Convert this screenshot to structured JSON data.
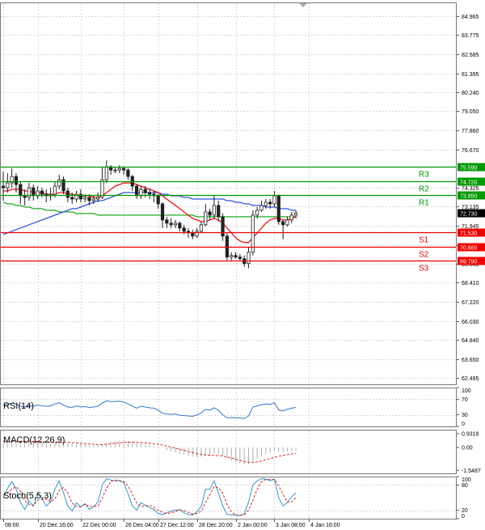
{
  "chart_data": {
    "type": "candlestick",
    "main": {
      "y_ticks": [
        "84.965",
        "83.775",
        "82.585",
        "81.395",
        "80.240",
        "79.050",
        "77.860",
        "76.670",
        "74.325",
        "73.135",
        "71.945",
        "70.755",
        "69.565",
        "68.410",
        "67.220",
        "66.030",
        "64.840",
        "63.650",
        "62.495"
      ],
      "y_tick_values": [
        84.965,
        83.775,
        82.585,
        81.395,
        80.24,
        79.05,
        77.86,
        76.67,
        74.325,
        73.135,
        71.945,
        70.755,
        69.565,
        68.41,
        67.22,
        66.03,
        64.84,
        63.65,
        62.495
      ],
      "ylim": [
        62.1,
        85.8
      ],
      "grid": true,
      "levels": [
        {
          "name": "R3",
          "value": 75.59,
          "label": "75.590",
          "color": "#009900"
        },
        {
          "name": "R2",
          "value": 74.72,
          "label": "74.720",
          "color": "#009900"
        },
        {
          "name": "R1",
          "value": 73.85,
          "label": "73.850",
          "color": "#009900"
        },
        {
          "name": "S1",
          "value": 71.53,
          "label": "71.530",
          "color": "#ee0000"
        },
        {
          "name": "S2",
          "value": 70.66,
          "label": "70.660",
          "color": "#ee0000"
        },
        {
          "name": "S3",
          "value": 69.79,
          "label": "69.790",
          "color": "#ee0000"
        }
      ],
      "current_price": {
        "value": 72.73,
        "label": "72.730"
      },
      "candles": [
        [
          74.4,
          74.3,
          75.3,
          73.5
        ],
        [
          74.3,
          74.6,
          75.2,
          74.0
        ],
        [
          74.6,
          75.0,
          75.5,
          74.3
        ],
        [
          75.0,
          74.5,
          75.2,
          74.0
        ],
        [
          74.5,
          73.8,
          74.7,
          73.3
        ],
        [
          73.8,
          73.7,
          74.2,
          73.2
        ],
        [
          73.7,
          74.3,
          74.6,
          73.5
        ],
        [
          74.3,
          73.8,
          74.5,
          73.5
        ],
        [
          73.8,
          74.1,
          74.4,
          73.6
        ],
        [
          74.1,
          73.9,
          74.3,
          73.7
        ],
        [
          73.9,
          73.8,
          74.2,
          73.4
        ],
        [
          73.8,
          73.9,
          74.3,
          73.5
        ],
        [
          73.9,
          74.4,
          74.7,
          73.7
        ],
        [
          74.4,
          74.8,
          75.1,
          74.2
        ],
        [
          74.8,
          74.1,
          75.0,
          73.9
        ],
        [
          74.1,
          73.7,
          74.3,
          73.4
        ],
        [
          73.7,
          73.6,
          74.0,
          73.3
        ],
        [
          73.6,
          73.9,
          74.1,
          73.4
        ],
        [
          73.9,
          73.6,
          74.2,
          73.4
        ],
        [
          73.6,
          73.7,
          73.9,
          73.4
        ],
        [
          73.7,
          73.5,
          73.9,
          73.2
        ],
        [
          73.5,
          73.6,
          73.8,
          73.3
        ],
        [
          73.6,
          73.7,
          74.0,
          73.4
        ],
        [
          73.7,
          74.8,
          75.6,
          73.6
        ],
        [
          74.8,
          75.6,
          76.0,
          74.6
        ],
        [
          75.6,
          75.4,
          75.7,
          75.1
        ],
        [
          75.4,
          75.4,
          75.6,
          75.2
        ],
        [
          75.4,
          75.5,
          75.7,
          75.2
        ],
        [
          75.5,
          75.4,
          75.6,
          75.1
        ],
        [
          75.4,
          75.0,
          75.5,
          74.8
        ],
        [
          75.0,
          74.4,
          75.1,
          74.1
        ],
        [
          74.4,
          73.8,
          74.5,
          73.6
        ],
        [
          73.8,
          74.2,
          74.4,
          73.6
        ],
        [
          74.2,
          74.0,
          74.4,
          73.7
        ],
        [
          74.0,
          73.9,
          74.2,
          73.6
        ],
        [
          73.9,
          73.8,
          74.1,
          73.4
        ],
        [
          73.8,
          73.3,
          73.9,
          73.0
        ],
        [
          73.3,
          72.3,
          73.4,
          71.8
        ],
        [
          72.3,
          72.1,
          72.5,
          71.8
        ],
        [
          72.1,
          72.0,
          72.4,
          71.8
        ],
        [
          72.0,
          72.1,
          72.3,
          71.8
        ],
        [
          72.1,
          71.8,
          72.2,
          71.6
        ],
        [
          71.8,
          71.6,
          72.0,
          71.4
        ],
        [
          71.6,
          71.5,
          71.8,
          71.2
        ],
        [
          71.5,
          71.3,
          71.7,
          71.1
        ],
        [
          71.3,
          71.6,
          71.8,
          71.2
        ],
        [
          71.6,
          72.0,
          72.2,
          71.5
        ],
        [
          72.0,
          72.8,
          73.3,
          71.9
        ],
        [
          72.8,
          72.6,
          73.0,
          72.3
        ],
        [
          72.6,
          73.2,
          73.8,
          72.4
        ],
        [
          73.2,
          72.5,
          73.5,
          72.2
        ],
        [
          72.5,
          71.3,
          72.7,
          71.0
        ],
        [
          71.3,
          70.0,
          71.5,
          69.8
        ],
        [
          70.0,
          70.1,
          70.3,
          69.8
        ],
        [
          70.1,
          70.0,
          70.3,
          69.9
        ],
        [
          70.0,
          69.9,
          70.2,
          69.8
        ],
        [
          69.9,
          69.6,
          70.1,
          69.4
        ],
        [
          69.6,
          70.3,
          70.6,
          69.3
        ],
        [
          70.3,
          72.6,
          72.9,
          70.1
        ],
        [
          72.6,
          72.9,
          73.1,
          72.4
        ],
        [
          72.9,
          73.2,
          73.5,
          72.8
        ],
        [
          73.2,
          73.4,
          73.6,
          73.0
        ],
        [
          73.4,
          73.3,
          73.6,
          73.0
        ],
        [
          73.3,
          73.8,
          74.1,
          73.1
        ],
        [
          73.8,
          72.2,
          73.9,
          72.0
        ],
        [
          72.2,
          72.0,
          72.3,
          71.1
        ],
        [
          72.0,
          72.3,
          72.5,
          71.9
        ],
        [
          72.3,
          72.6,
          72.8,
          72.1
        ],
        [
          72.6,
          72.73,
          72.9,
          72.4
        ]
      ],
      "ma_red": [
        74.1,
        74.1,
        74.2,
        74.2,
        74.2,
        74.1,
        74.1,
        74.0,
        74.0,
        74.0,
        73.9,
        73.9,
        73.9,
        74.0,
        74.0,
        73.9,
        73.9,
        73.8,
        73.8,
        73.8,
        73.8,
        73.7,
        73.7,
        73.8,
        74.0,
        74.2,
        74.4,
        74.5,
        74.6,
        74.6,
        74.6,
        74.5,
        74.4,
        74.3,
        74.2,
        74.1,
        74.0,
        73.8,
        73.6,
        73.4,
        73.2,
        73.0,
        72.8,
        72.6,
        72.4,
        72.3,
        72.2,
        72.2,
        72.3,
        72.4,
        72.3,
        72.1,
        71.8,
        71.5,
        71.2,
        71.0,
        70.9,
        70.9,
        71.2,
        71.5,
        71.8,
        72.1,
        72.3,
        72.4,
        72.4,
        72.3,
        72.3,
        72.4,
        72.5
      ],
      "ma_blue": [
        71.4,
        71.5,
        71.6,
        71.7,
        71.8,
        71.9,
        72.0,
        72.1,
        72.2,
        72.3,
        72.4,
        72.5,
        72.6,
        72.7,
        72.8,
        72.9,
        73.0,
        73.0,
        73.1,
        73.2,
        73.3,
        73.4,
        73.5,
        73.5,
        73.6,
        73.7,
        73.8,
        73.9,
        74.0,
        74.0,
        74.0,
        74.0,
        74.0,
        74.0,
        74.0,
        74.0,
        74.0,
        73.9,
        73.9,
        73.8,
        73.8,
        73.8,
        73.7,
        73.7,
        73.6,
        73.6,
        73.6,
        73.6,
        73.6,
        73.6,
        73.6,
        73.6,
        73.5,
        73.5,
        73.4,
        73.4,
        73.3,
        73.3,
        73.2,
        73.2,
        73.2,
        73.1,
        73.1,
        73.1,
        73.0,
        73.0,
        73.0,
        72.9,
        72.9
      ],
      "ma_green": [
        73.4,
        73.3,
        73.3,
        73.2,
        73.2,
        73.1,
        73.1,
        73.0,
        73.0,
        73.0,
        72.9,
        72.9,
        72.9,
        72.8,
        72.8,
        72.8,
        72.8,
        72.7,
        72.7,
        72.7,
        72.7,
        72.7,
        72.6,
        72.6,
        72.6,
        72.6,
        72.6,
        72.6,
        72.6,
        72.6,
        72.6,
        72.6,
        72.6,
        72.6,
        72.6,
        72.6,
        72.6,
        72.6,
        72.6,
        72.6,
        72.6,
        72.6,
        72.6,
        72.6,
        72.6,
        72.5,
        72.5,
        72.5,
        72.5,
        72.5,
        72.5,
        72.5,
        72.5,
        72.5,
        72.5,
        72.5,
        72.5,
        72.5,
        72.5,
        72.5,
        72.5,
        72.5,
        72.5,
        72.5,
        72.5,
        72.5,
        72.5,
        72.5,
        72.5
      ]
    },
    "rsi": {
      "label": "RSI(14)",
      "y_ticks": [
        "100",
        "70",
        "30",
        "0"
      ],
      "y_tick_values": [
        100,
        70,
        30,
        0
      ],
      "ylim": [
        0,
        100
      ],
      "values": [
        55,
        57,
        60,
        57,
        52,
        50,
        54,
        52,
        55,
        53,
        52,
        53,
        58,
        61,
        55,
        50,
        49,
        53,
        50,
        51,
        49,
        50,
        52,
        60,
        66,
        64,
        64,
        65,
        63,
        58,
        52,
        47,
        52,
        50,
        48,
        47,
        42,
        34,
        32,
        31,
        32,
        29,
        28,
        27,
        26,
        30,
        35,
        44,
        42,
        48,
        41,
        30,
        22,
        23,
        22,
        22,
        20,
        27,
        50,
        53,
        56,
        58,
        57,
        61,
        42,
        40,
        44,
        47,
        49
      ]
    },
    "macd": {
      "label": "MACD(12,26,9)",
      "y_ticks": [
        "0.9318",
        "0.00",
        "-1.5487"
      ],
      "y_tick_values": [
        0.9318,
        0,
        -1.5487
      ],
      "ylim": [
        -1.75,
        1.2
      ],
      "hist": [
        0.3,
        0.35,
        0.4,
        0.42,
        0.4,
        0.36,
        0.36,
        0.34,
        0.34,
        0.32,
        0.3,
        0.28,
        0.3,
        0.34,
        0.32,
        0.28,
        0.24,
        0.23,
        0.2,
        0.18,
        0.15,
        0.13,
        0.12,
        0.2,
        0.32,
        0.4,
        0.44,
        0.46,
        0.46,
        0.43,
        0.36,
        0.28,
        0.24,
        0.2,
        0.16,
        0.12,
        0.06,
        -0.06,
        -0.18,
        -0.27,
        -0.34,
        -0.42,
        -0.5,
        -0.56,
        -0.62,
        -0.64,
        -0.62,
        -0.56,
        -0.52,
        -0.44,
        -0.46,
        -0.58,
        -0.76,
        -0.88,
        -0.98,
        -1.06,
        -1.14,
        -1.12,
        -0.92,
        -0.76,
        -0.6,
        -0.46,
        -0.36,
        -0.24,
        -0.28,
        -0.3,
        -0.28,
        -0.24,
        -0.2
      ],
      "signal": [
        0.4,
        0.4,
        0.4,
        0.4,
        0.41,
        0.41,
        0.41,
        0.4,
        0.4,
        0.39,
        0.38,
        0.36,
        0.35,
        0.35,
        0.35,
        0.34,
        0.32,
        0.3,
        0.28,
        0.26,
        0.24,
        0.21,
        0.19,
        0.19,
        0.21,
        0.25,
        0.28,
        0.31,
        0.34,
        0.36,
        0.36,
        0.35,
        0.33,
        0.31,
        0.28,
        0.25,
        0.21,
        0.16,
        0.09,
        0.02,
        -0.05,
        -0.13,
        -0.2,
        -0.28,
        -0.35,
        -0.42,
        -0.47,
        -0.51,
        -0.53,
        -0.54,
        -0.55,
        -0.58,
        -0.64,
        -0.71,
        -0.79,
        -0.87,
        -0.94,
        -1.0,
        -1.01,
        -0.98,
        -0.92,
        -0.84,
        -0.76,
        -0.67,
        -0.6,
        -0.54,
        -0.49,
        -0.44,
        -0.4
      ]
    },
    "stoch": {
      "label": "Stoch(5,5,3)",
      "y_ticks": [
        "100",
        "80",
        "20",
        "0"
      ],
      "y_tick_values": [
        100,
        80,
        20,
        0
      ],
      "ylim": [
        0,
        100
      ],
      "k": [
        50,
        72,
        88,
        70,
        38,
        22,
        42,
        30,
        60,
        48,
        30,
        40,
        70,
        90,
        62,
        30,
        18,
        38,
        28,
        36,
        22,
        28,
        40,
        80,
        95,
        92,
        90,
        90,
        85,
        60,
        30,
        20,
        38,
        32,
        26,
        22,
        12,
        10,
        14,
        18,
        20,
        22,
        14,
        10,
        9,
        16,
        30,
        70,
        70,
        90,
        60,
        30,
        10,
        9,
        8,
        7,
        12,
        40,
        80,
        90,
        95,
        94,
        90,
        94,
        50,
        30,
        38,
        52,
        62
      ],
      "d": [
        56,
        62,
        70,
        76,
        65,
        43,
        34,
        31,
        44,
        46,
        46,
        39,
        47,
        67,
        74,
        61,
        37,
        29,
        28,
        34,
        29,
        29,
        30,
        49,
        72,
        89,
        92,
        91,
        88,
        78,
        58,
        37,
        29,
        30,
        32,
        27,
        20,
        15,
        12,
        14,
        17,
        20,
        19,
        15,
        11,
        12,
        18,
        39,
        57,
        77,
        73,
        60,
        33,
        16,
        9,
        8,
        9,
        20,
        44,
        70,
        88,
        93,
        93,
        93,
        78,
        58,
        39,
        40,
        51
      ]
    },
    "x_labels": [
      "08:00",
      "20 Dec 16:00",
      "22 Dec 00:00",
      "26 Dec 04:00",
      "27 Dec 12:00",
      "28 Dec 20:00",
      "2 Jan 00:00",
      "3 Jan 08:00",
      "4 Jan 16:00"
    ],
    "x_label_index": [
      0,
      8,
      18,
      28,
      36,
      45,
      54,
      63,
      71
    ],
    "colors": {
      "grid": "#d7d7d7",
      "up_candle": "#20a020",
      "down_candle": "#e02020",
      "ma_red": "#ee1111",
      "ma_blue": "#3355dd",
      "ma_green": "#22aa22",
      "rsi_line": "#3377cc",
      "macd_hist": "#b0b0b0",
      "macd_signal": "#dd2222",
      "stoch_k": "#3399cc",
      "stoch_d": "#dd2222",
      "current_price_box": "#000000"
    }
  }
}
